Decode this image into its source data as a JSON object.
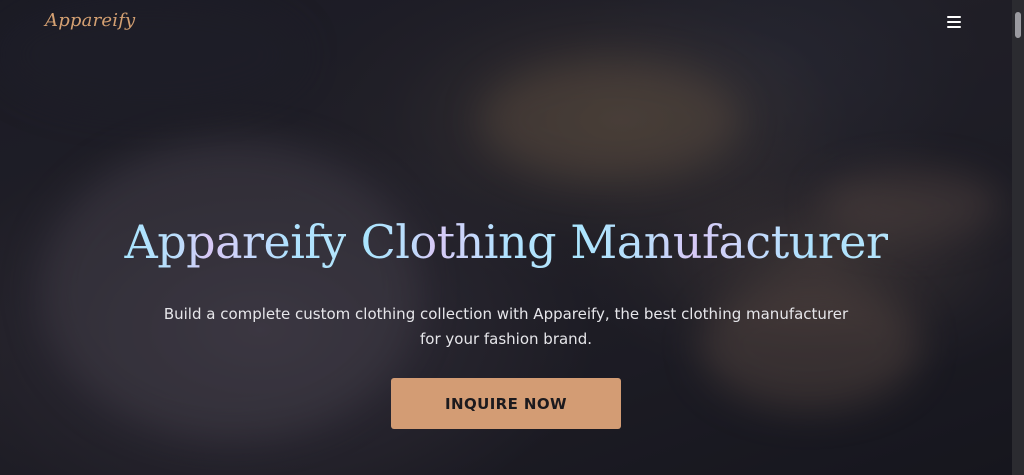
{
  "header": {
    "logo_text": "Appareify",
    "menu_icon": "hamburger-menu-icon",
    "logo_color": "#d4a072"
  },
  "hero": {
    "title_part1": "Appareify",
    "title_part2": "Clothing",
    "title_part3": "Manufacturer",
    "subtitle": "Build a complete custom clothing collection with Appareify, the best clothing manufacturer for your fashion brand.",
    "cta_label": "INQUIRE NOW",
    "cta_color": "#d39c74",
    "title_gradient": [
      "#a9e6ff",
      "#d8c8f6",
      "#aee2ff"
    ]
  }
}
